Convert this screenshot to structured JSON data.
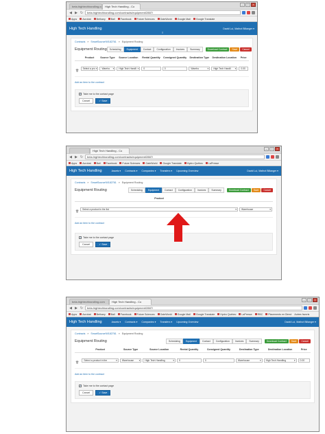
{
  "browser": {
    "tab_prev": "beta.hightechhandling.com",
    "tab_active": "High Tech Handling - Co",
    "back": "◀",
    "forward": "▶",
    "reload": "↻",
    "url_top": "beta.hightechhandling.com/contracts/equipment/2887/",
    "url_mid": "beta.hightechhandling.com/contracts/equipment/2887/",
    "url_bottom": "beta.hightechhandling.com/contracts/equipment/2887/",
    "bookmarks": [
      "Apps",
      "Acrobat",
      "Bethany",
      "Ball",
      "Facebook",
      "Future Sciences",
      "GateWorld",
      "Google Mail",
      "Google Translate"
    ],
    "bookmarks_extra": [
      "Hydro Québec",
      "LaPresse",
      "RBC",
      "Placements en Direct"
    ],
    "other_bookmarks": "Autres favoris",
    "min": "–",
    "max": "□",
    "close": "×"
  },
  "app": {
    "brand": "High Tech Handling",
    "menu": [
      "Assets ▾",
      "Contracts ▾",
      "Companies ▾",
      "Transfers ▾",
      "Upcoming Overview"
    ],
    "user": "David Lui, Mathot Billanger ▾",
    "grip": "≡"
  },
  "breadcrumb": {
    "root": "Contracts",
    "contract": "SmartSource/W182761",
    "current": "Equipment Routing",
    "sep": "»"
  },
  "page": {
    "title": "Equipment Routing",
    "tabs": [
      "Scheduling",
      "Equipment",
      "Contact",
      "Configuration",
      "Invoices",
      "Summary"
    ],
    "active_tab": "Equipment",
    "download": "Download Contract",
    "save": "Save",
    "cancel": "Cancel"
  },
  "table_full": {
    "headers": [
      "",
      "Product",
      "Source Type",
      "Source Location",
      "Rental Quantity",
      "Consigned Quantity",
      "Destination Type",
      "Destination Location",
      "Price"
    ],
    "row_top": [
      "Select a pro",
      "Wareho",
      "High Tech Handli",
      "0",
      "0",
      "Wareho",
      "High Tech Handli",
      "0.00"
    ],
    "row_bottom": [
      "Select a product in the",
      "Warehouse",
      "High Tech Handling",
      "0",
      "0",
      "Warehouse",
      "High Tech Handling",
      "0.00"
    ]
  },
  "table_mid": {
    "header": "Product",
    "placeholder": "Select a product in the list",
    "source": "Warehouse"
  },
  "footer": {
    "add_item": "Add an item to the contract",
    "take_me": "Take me to the contact page",
    "cancel": "Cancel",
    "save": "✓ Save",
    "check": "✓"
  },
  "arrow_color": "#e01919"
}
